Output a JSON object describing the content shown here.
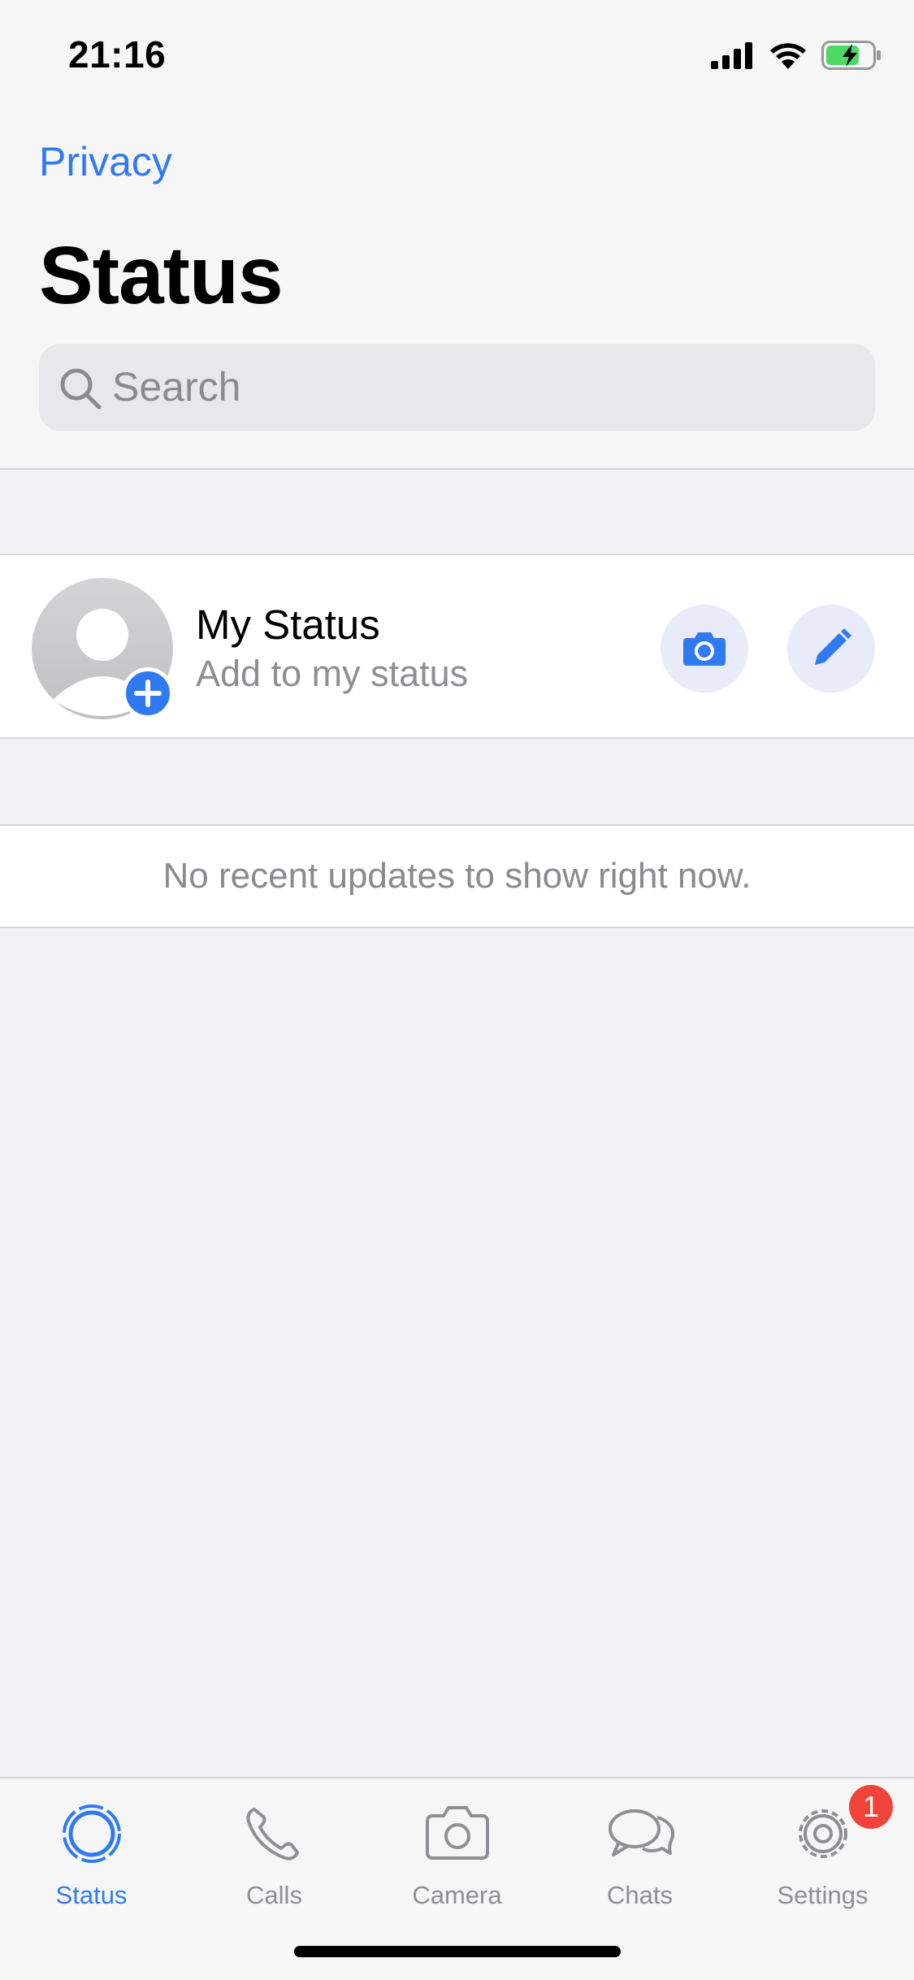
{
  "status_bar": {
    "time": "21:16"
  },
  "nav": {
    "privacy_label": "Privacy"
  },
  "page": {
    "title": "Status"
  },
  "search": {
    "placeholder": "Search"
  },
  "my_status": {
    "title": "My Status",
    "subtitle": "Add to my status",
    "icons": [
      "camera-icon",
      "pencil-icon",
      "plus-icon"
    ]
  },
  "updates": {
    "empty_message": "No recent updates to show right now."
  },
  "tab_bar": {
    "tabs": [
      {
        "label": "Status",
        "icon": "status-ring-icon",
        "active": true
      },
      {
        "label": "Calls",
        "icon": "phone-icon",
        "active": false
      },
      {
        "label": "Camera",
        "icon": "camera-icon",
        "active": false
      },
      {
        "label": "Chats",
        "icon": "chat-bubbles-icon",
        "active": false
      },
      {
        "label": "Settings",
        "icon": "gear-icon",
        "active": false
      }
    ],
    "settings_badge": "1"
  },
  "colors": {
    "accent": "#2f7af2",
    "badge": "#f0433a",
    "background": "#f1f1f6"
  }
}
